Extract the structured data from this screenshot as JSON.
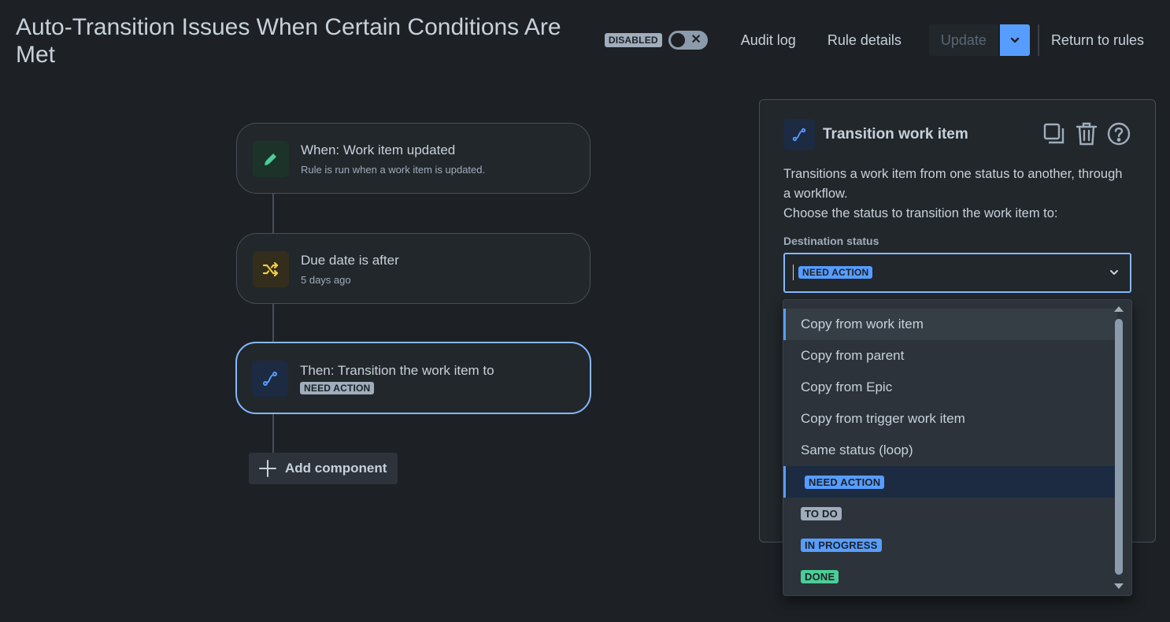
{
  "header": {
    "title": "Auto-Transition Issues When Certain Conditions Are Met",
    "status_badge": "DISABLED",
    "toggle_icon": "x-icon",
    "audit_log": "Audit log",
    "rule_details": "Rule details",
    "update": "Update",
    "return": "Return to rules"
  },
  "flow": {
    "trigger": {
      "title": "When: Work item updated",
      "subtitle": "Rule is run when a work item is updated.",
      "icon": "pencil-icon",
      "color": "#4bce97"
    },
    "condition": {
      "title": "Due date is after",
      "subtitle": "5 days ago",
      "icon": "shuffle-icon",
      "color": "#f5cd47"
    },
    "action": {
      "title": "Then: Transition the work item to",
      "status": "NEED ACTION",
      "icon": "transition-icon",
      "color": "#579dff"
    },
    "add_component": "Add component"
  },
  "panel": {
    "title": "Transition work item",
    "description_line1": "Transitions a work item from one status to another, through a workflow.",
    "description_line2": "Choose the status to transition the work item to:",
    "field_label": "Destination status",
    "selected_value": "NEED ACTION"
  },
  "menu": {
    "items": [
      {
        "label": "Copy from work item"
      },
      {
        "label": "Copy from parent"
      },
      {
        "label": "Copy from Epic"
      },
      {
        "label": "Copy from trigger work item"
      },
      {
        "label": "Same status (loop)"
      }
    ],
    "statuses": [
      {
        "label": "NEED ACTION",
        "color": "#579dff"
      },
      {
        "label": "TO DO",
        "color": "#9fadbc"
      },
      {
        "label": "IN PROGRESS",
        "color": "#579dff"
      },
      {
        "label": "DONE",
        "color": "#4bce97"
      }
    ]
  }
}
